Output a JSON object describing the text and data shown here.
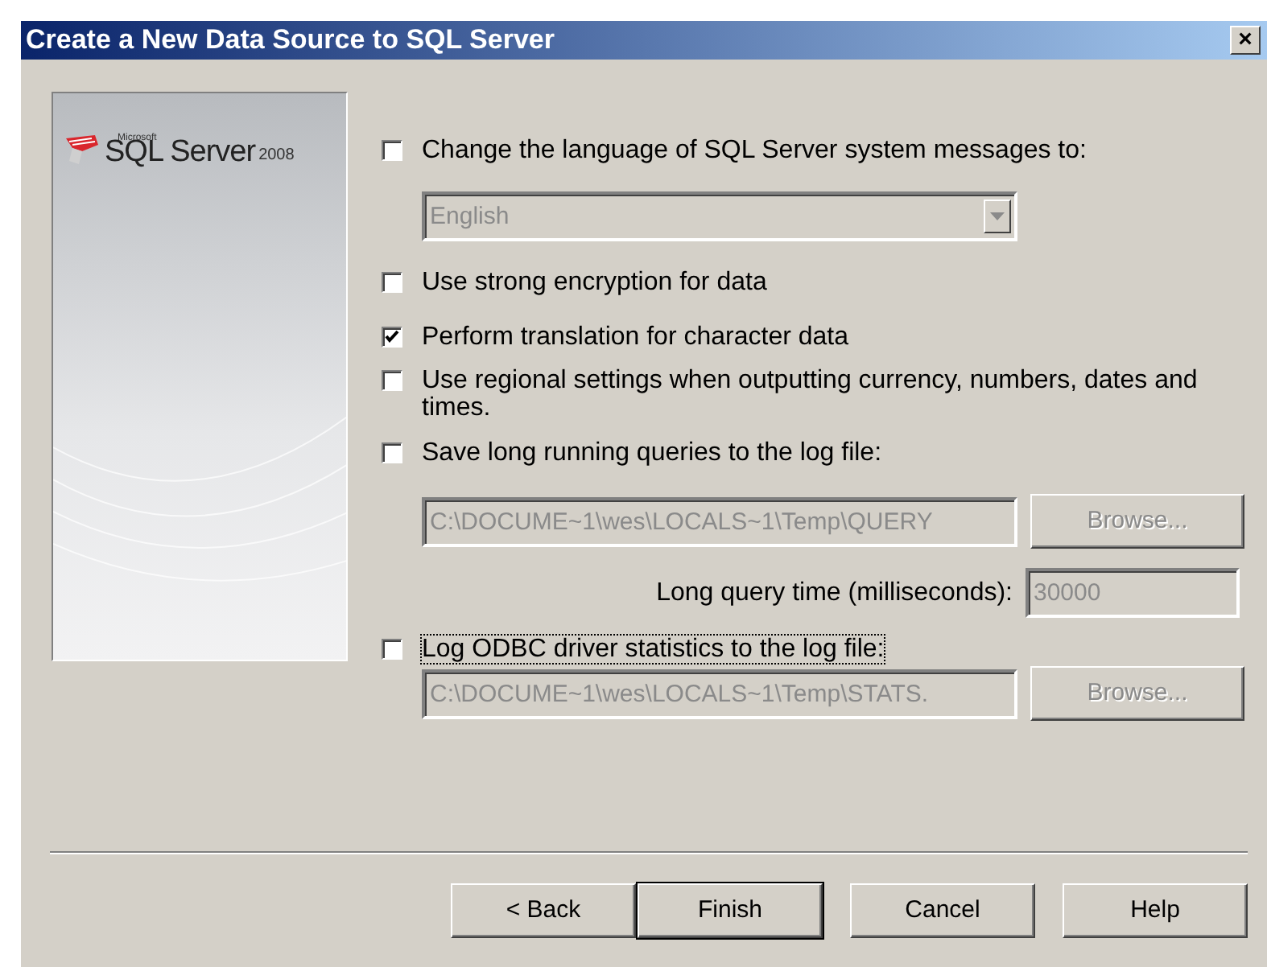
{
  "window": {
    "title": "Create a New Data Source to SQL Server",
    "close": "×"
  },
  "logo": {
    "small": "Microsoft",
    "name": "SQL Server",
    "version": "2008"
  },
  "options": [
    {
      "kind": "checkbox",
      "label": "Change the language of SQL Server system messages to:",
      "checked": false,
      "focused": false
    },
    {
      "kind": "combo",
      "value": "English",
      "disabled": true
    },
    {
      "kind": "checkbox",
      "label": "Use strong encryption for data",
      "checked": false,
      "focused": false
    },
    {
      "kind": "checkbox",
      "label": "Perform translation for character data",
      "checked": true,
      "focused": false
    },
    {
      "kind": "checkbox",
      "label": "Use regional settings when outputting currency, numbers, dates and times.",
      "checked": false,
      "focused": false
    },
    {
      "kind": "checkbox",
      "label": "Save long running queries to the log file:",
      "checked": false,
      "focused": false
    },
    {
      "kind": "path",
      "value": "C:\\DOCUME~1\\wes\\LOCALS~1\\Temp\\QUERY",
      "button": "Browse...",
      "disabled": true
    },
    {
      "kind": "number",
      "label": "Long query time (milliseconds):",
      "value": "30000",
      "disabled": true
    },
    {
      "kind": "checkbox",
      "label": "Log ODBC driver statistics to the log file:",
      "checked": false,
      "focused": true
    },
    {
      "kind": "path",
      "value": "C:\\DOCUME~1\\wes\\LOCALS~1\\Temp\\STATS.",
      "button": "Browse...",
      "disabled": true
    }
  ],
  "buttons": [
    {
      "label": "< Back",
      "default": false
    },
    {
      "label": "Finish",
      "default": true
    },
    {
      "label": "Cancel",
      "default": false
    },
    {
      "label": "Help",
      "default": false
    }
  ]
}
